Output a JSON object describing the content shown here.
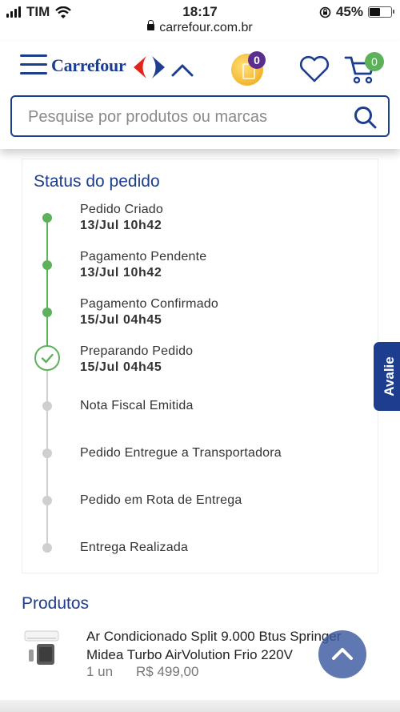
{
  "status_bar": {
    "carrier": "TIM",
    "time": "18:17",
    "battery": "45%"
  },
  "url": "carrefour.com.br",
  "header": {
    "brand": "Carrefour",
    "coins_badge": "0",
    "cart_badge": "0",
    "search_placeholder": "Pesquise por produtos ou marcas"
  },
  "order_status": {
    "title": "Status do pedido",
    "steps": [
      {
        "label": "Pedido Criado",
        "date": "13/Jul 10h42",
        "state": "done"
      },
      {
        "label": "Pagamento Pendente",
        "date": "13/Jul 10h42",
        "state": "done"
      },
      {
        "label": "Pagamento Confirmado",
        "date": "15/Jul 04h45",
        "state": "done"
      },
      {
        "label": "Preparando Pedido",
        "date": "15/Jul 04h45",
        "state": "current"
      },
      {
        "label": "Nota Fiscal Emitida",
        "state": "pending"
      },
      {
        "label": "Pedido Entregue a Transportadora",
        "state": "pending"
      },
      {
        "label": "Pedido em Rota de Entrega",
        "state": "pending"
      },
      {
        "label": "Entrega Realizada",
        "state": "pending"
      }
    ]
  },
  "feedback_tab": "Avalie",
  "products": {
    "title": "Produtos",
    "items": [
      {
        "name_line1": "Ar Condicionado Split 9.000 Btus Springer",
        "name_line2": "Midea Turbo AirVolution Frio 220V",
        "quantity": "1 un",
        "price": "R$ 499,00"
      }
    ]
  },
  "colors": {
    "brand_blue": "#1d3d8f",
    "brand_red": "#e1251b",
    "done_green": "#5cb15a",
    "pending_grey": "#cfcfcf"
  }
}
